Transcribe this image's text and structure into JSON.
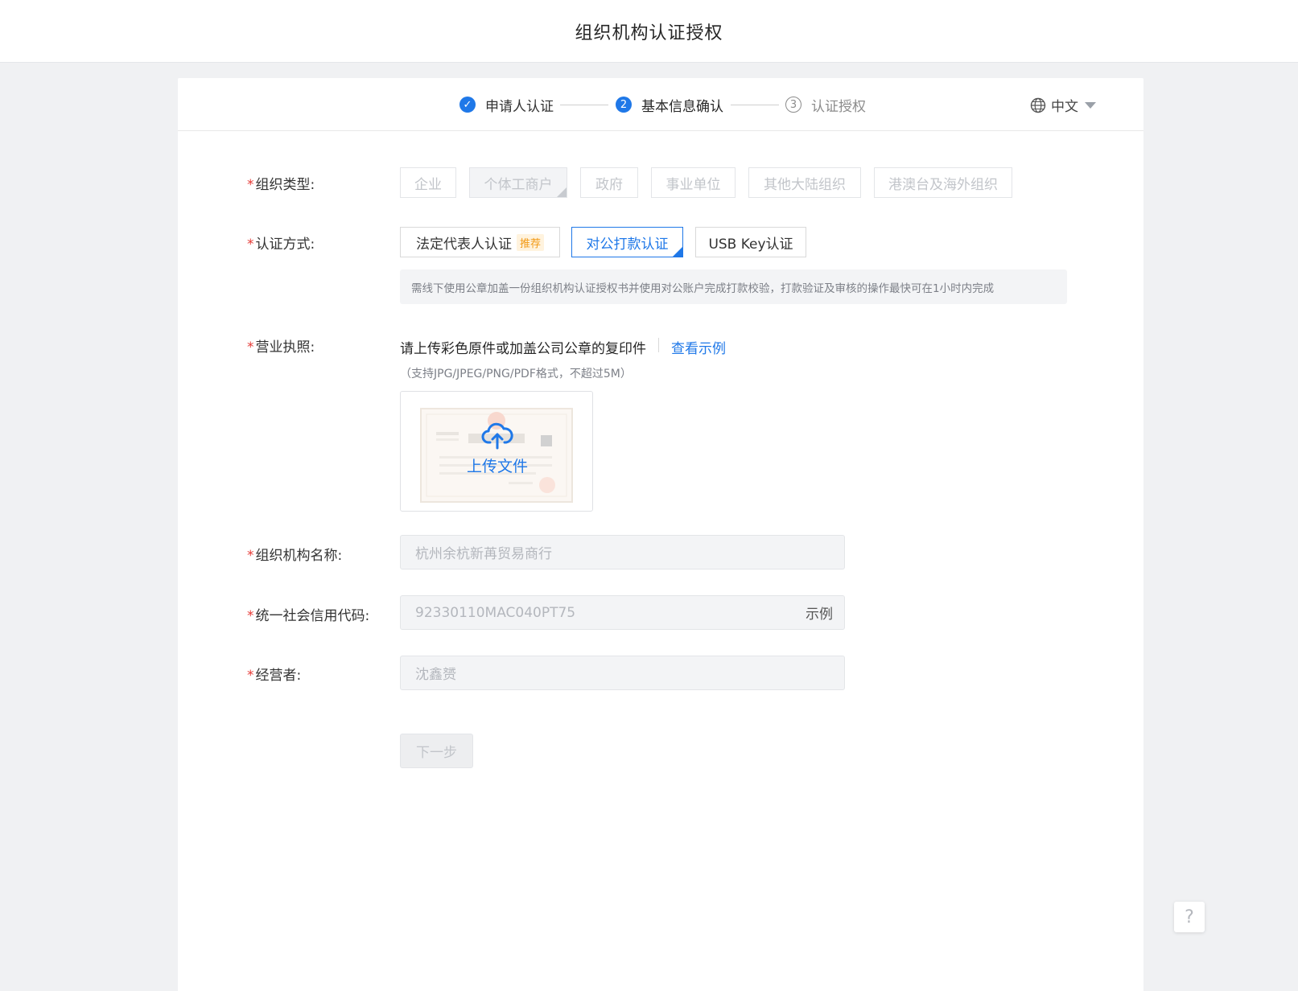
{
  "header": {
    "title": "组织机构认证授权"
  },
  "steps": [
    {
      "label": "申请人认证",
      "status": "done",
      "marker": "✓"
    },
    {
      "label": "基本信息确认",
      "status": "active",
      "marker": "2"
    },
    {
      "label": "认证授权",
      "status": "pending",
      "marker": "3"
    }
  ],
  "language": {
    "label": "中文"
  },
  "org_type": {
    "label": "组织类型:",
    "options": [
      "企业",
      "个体工商户",
      "政府",
      "事业单位",
      "其他大陆组织",
      "港澳台及海外组织"
    ],
    "selected": "个体工商户"
  },
  "auth_method": {
    "label": "认证方式:",
    "options": [
      "法定代表人认证",
      "对公打款认证",
      "USB Key认证"
    ],
    "recommend_badge": "推荐",
    "selected": "对公打款认证",
    "tip": "需线下使用公章加盖一份组织机构认证授权书并使用对公账户完成打款校验，打款验证及审核的操作最快可在1小时内完成"
  },
  "license": {
    "label": "营业执照:",
    "hint": "请上传彩色原件或加盖公司公章的复印件",
    "example_link": "查看示例",
    "format_note": "（支持JPG/JPEG/PNG/PDF格式，不超过5M）",
    "upload_label": "上传文件"
  },
  "fields": {
    "org_name": {
      "label": "组织机构名称:",
      "value": "杭州余杭新苒贸易商行"
    },
    "credit_code": {
      "label": "统一社会信用代码:",
      "value": "92330110MAC040PT75",
      "suffix": "示例"
    },
    "operator": {
      "label": "经营者:",
      "value": "沈鑫赟"
    }
  },
  "next_button": "下一步",
  "help_button": "?",
  "colors": {
    "primary": "#1f78e8",
    "required": "#e53935",
    "recommend": "#f29a16"
  }
}
